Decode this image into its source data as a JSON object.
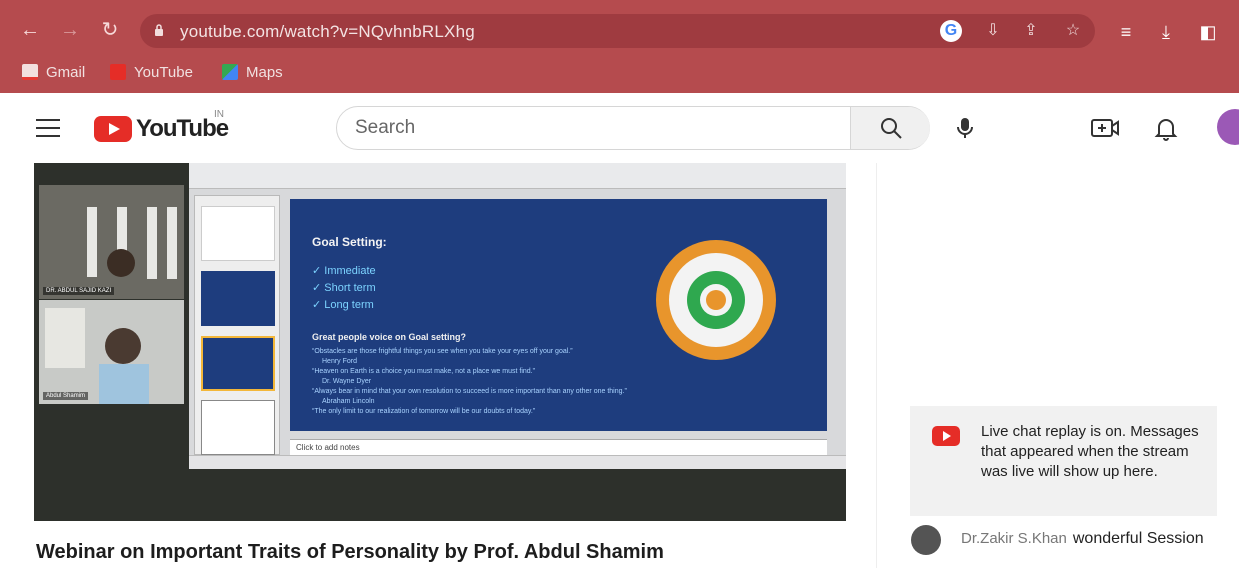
{
  "browser": {
    "url": "youtube.com/watch?v=NQvhnbRLXhg",
    "bookmarks": [
      {
        "label": "Gmail",
        "icon": "gmail-icon",
        "color": "#e53935"
      },
      {
        "label": "YouTube",
        "icon": "youtube-icon",
        "color": "#e52d27"
      },
      {
        "label": "Maps",
        "icon": "maps-icon",
        "color": "#34a853"
      }
    ]
  },
  "youtube": {
    "logo": "YouTube",
    "region": "IN",
    "search_placeholder": "Search"
  },
  "video": {
    "title": "Webinar on Important Traits of Personality by Prof. Abdul Shamim",
    "participants": [
      {
        "name": "DR. ABDUL SAJID KAZI"
      },
      {
        "name": "Abdul Shamim"
      }
    ],
    "slide": {
      "heading": "Goal Setting:",
      "items": [
        "Immediate",
        "Short term",
        "Long term"
      ],
      "subheading": "Great people voice on Goal setting?",
      "quotes": [
        "“Obstacles are those frightful things you see when you take your eyes off your goal.”",
        "Henry Ford",
        "“Heaven on Earth is a choice you must make, not a place we must find.”",
        "Dr. Wayne Dyer",
        "“Always bear in mind that your own resolution to succeed is more important than any other one thing.”",
        "Abraham Lincoln",
        "“The only limit to our realization of tomorrow will be our doubts of today.”"
      ],
      "notes_placeholder": "Click to add notes"
    },
    "colors": {
      "slide_bg": "#1e3d7e",
      "target_outer": "#e8952c",
      "target_mid": "#2fa84f",
      "target_center": "#e8952c"
    }
  },
  "chat": {
    "notice": "Live chat replay is on. Messages that appeared when the stream was live will show up here.",
    "messages": [
      {
        "author": "Dr.Zakir S.Khan",
        "text": "wonderful Session"
      }
    ]
  }
}
